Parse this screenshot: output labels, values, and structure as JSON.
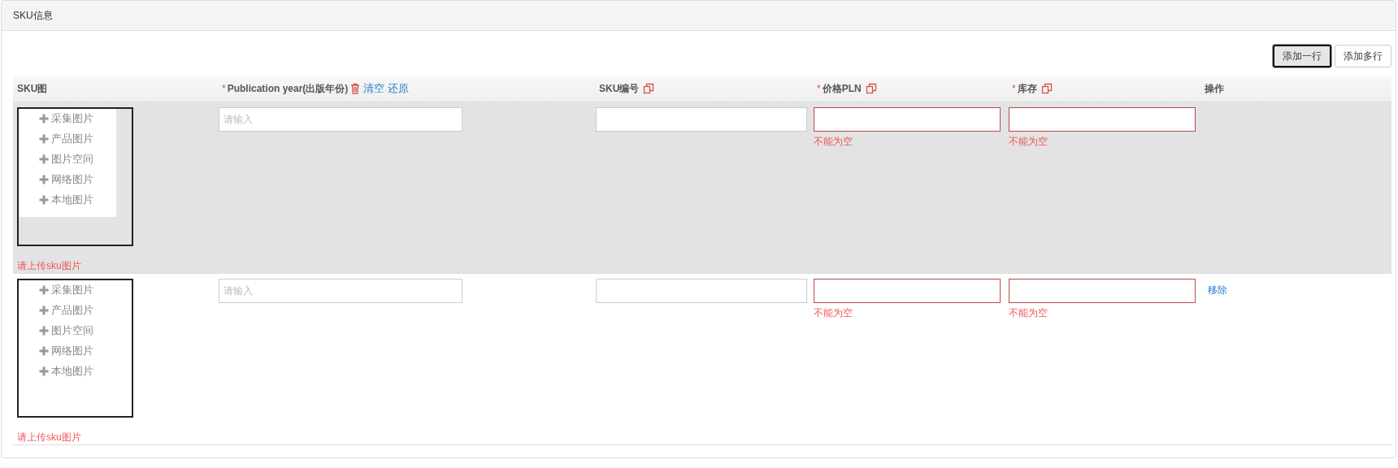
{
  "panel": {
    "title": "SKU信息"
  },
  "buttons": [
    {
      "label": "添加一行",
      "focused": true
    },
    {
      "label": "添加多行",
      "focused": false
    }
  ],
  "columns": [
    {
      "label": "SKU图"
    },
    {
      "label": "Publication year(出版年份)",
      "marker": "*",
      "tools": [
        {
          "kind": "trash"
        },
        {
          "kind": "link",
          "label": "清空"
        },
        {
          "kind": "link",
          "label": "还原"
        }
      ]
    },
    {
      "label": "SKU编号",
      "tools": [
        {
          "kind": "copy"
        }
      ]
    },
    {
      "label": "价格PLN",
      "marker": "*",
      "tools": [
        {
          "kind": "copy"
        }
      ]
    },
    {
      "label": "库存",
      "marker": "*",
      "tools": [
        {
          "kind": "copy"
        }
      ]
    },
    {
      "label": "操作"
    }
  ],
  "rows": [
    {
      "highlighted": true,
      "image_menu": [
        "采集图片",
        "产品图片",
        "图片空间",
        "网络图片",
        "本地图片"
      ],
      "image_error": "请上传sku图片",
      "publication_year": {
        "placeholder": "请输入"
      },
      "sku_code": {},
      "price": {
        "invalid": true,
        "error": "不能为空"
      },
      "stock": {
        "invalid": true,
        "error": "不能为空"
      }
    },
    {
      "highlighted": false,
      "image_menu": [
        "采集图片",
        "产品图片",
        "图片空间",
        "网络图片",
        "本地图片"
      ],
      "image_error": "请上传sku图片",
      "publication_year": {
        "placeholder": "请输入"
      },
      "sku_code": {},
      "price": {
        "invalid": true,
        "error": "不能为空"
      },
      "stock": {
        "invalid": true,
        "error": "不能为空"
      },
      "action": "移除"
    }
  ]
}
